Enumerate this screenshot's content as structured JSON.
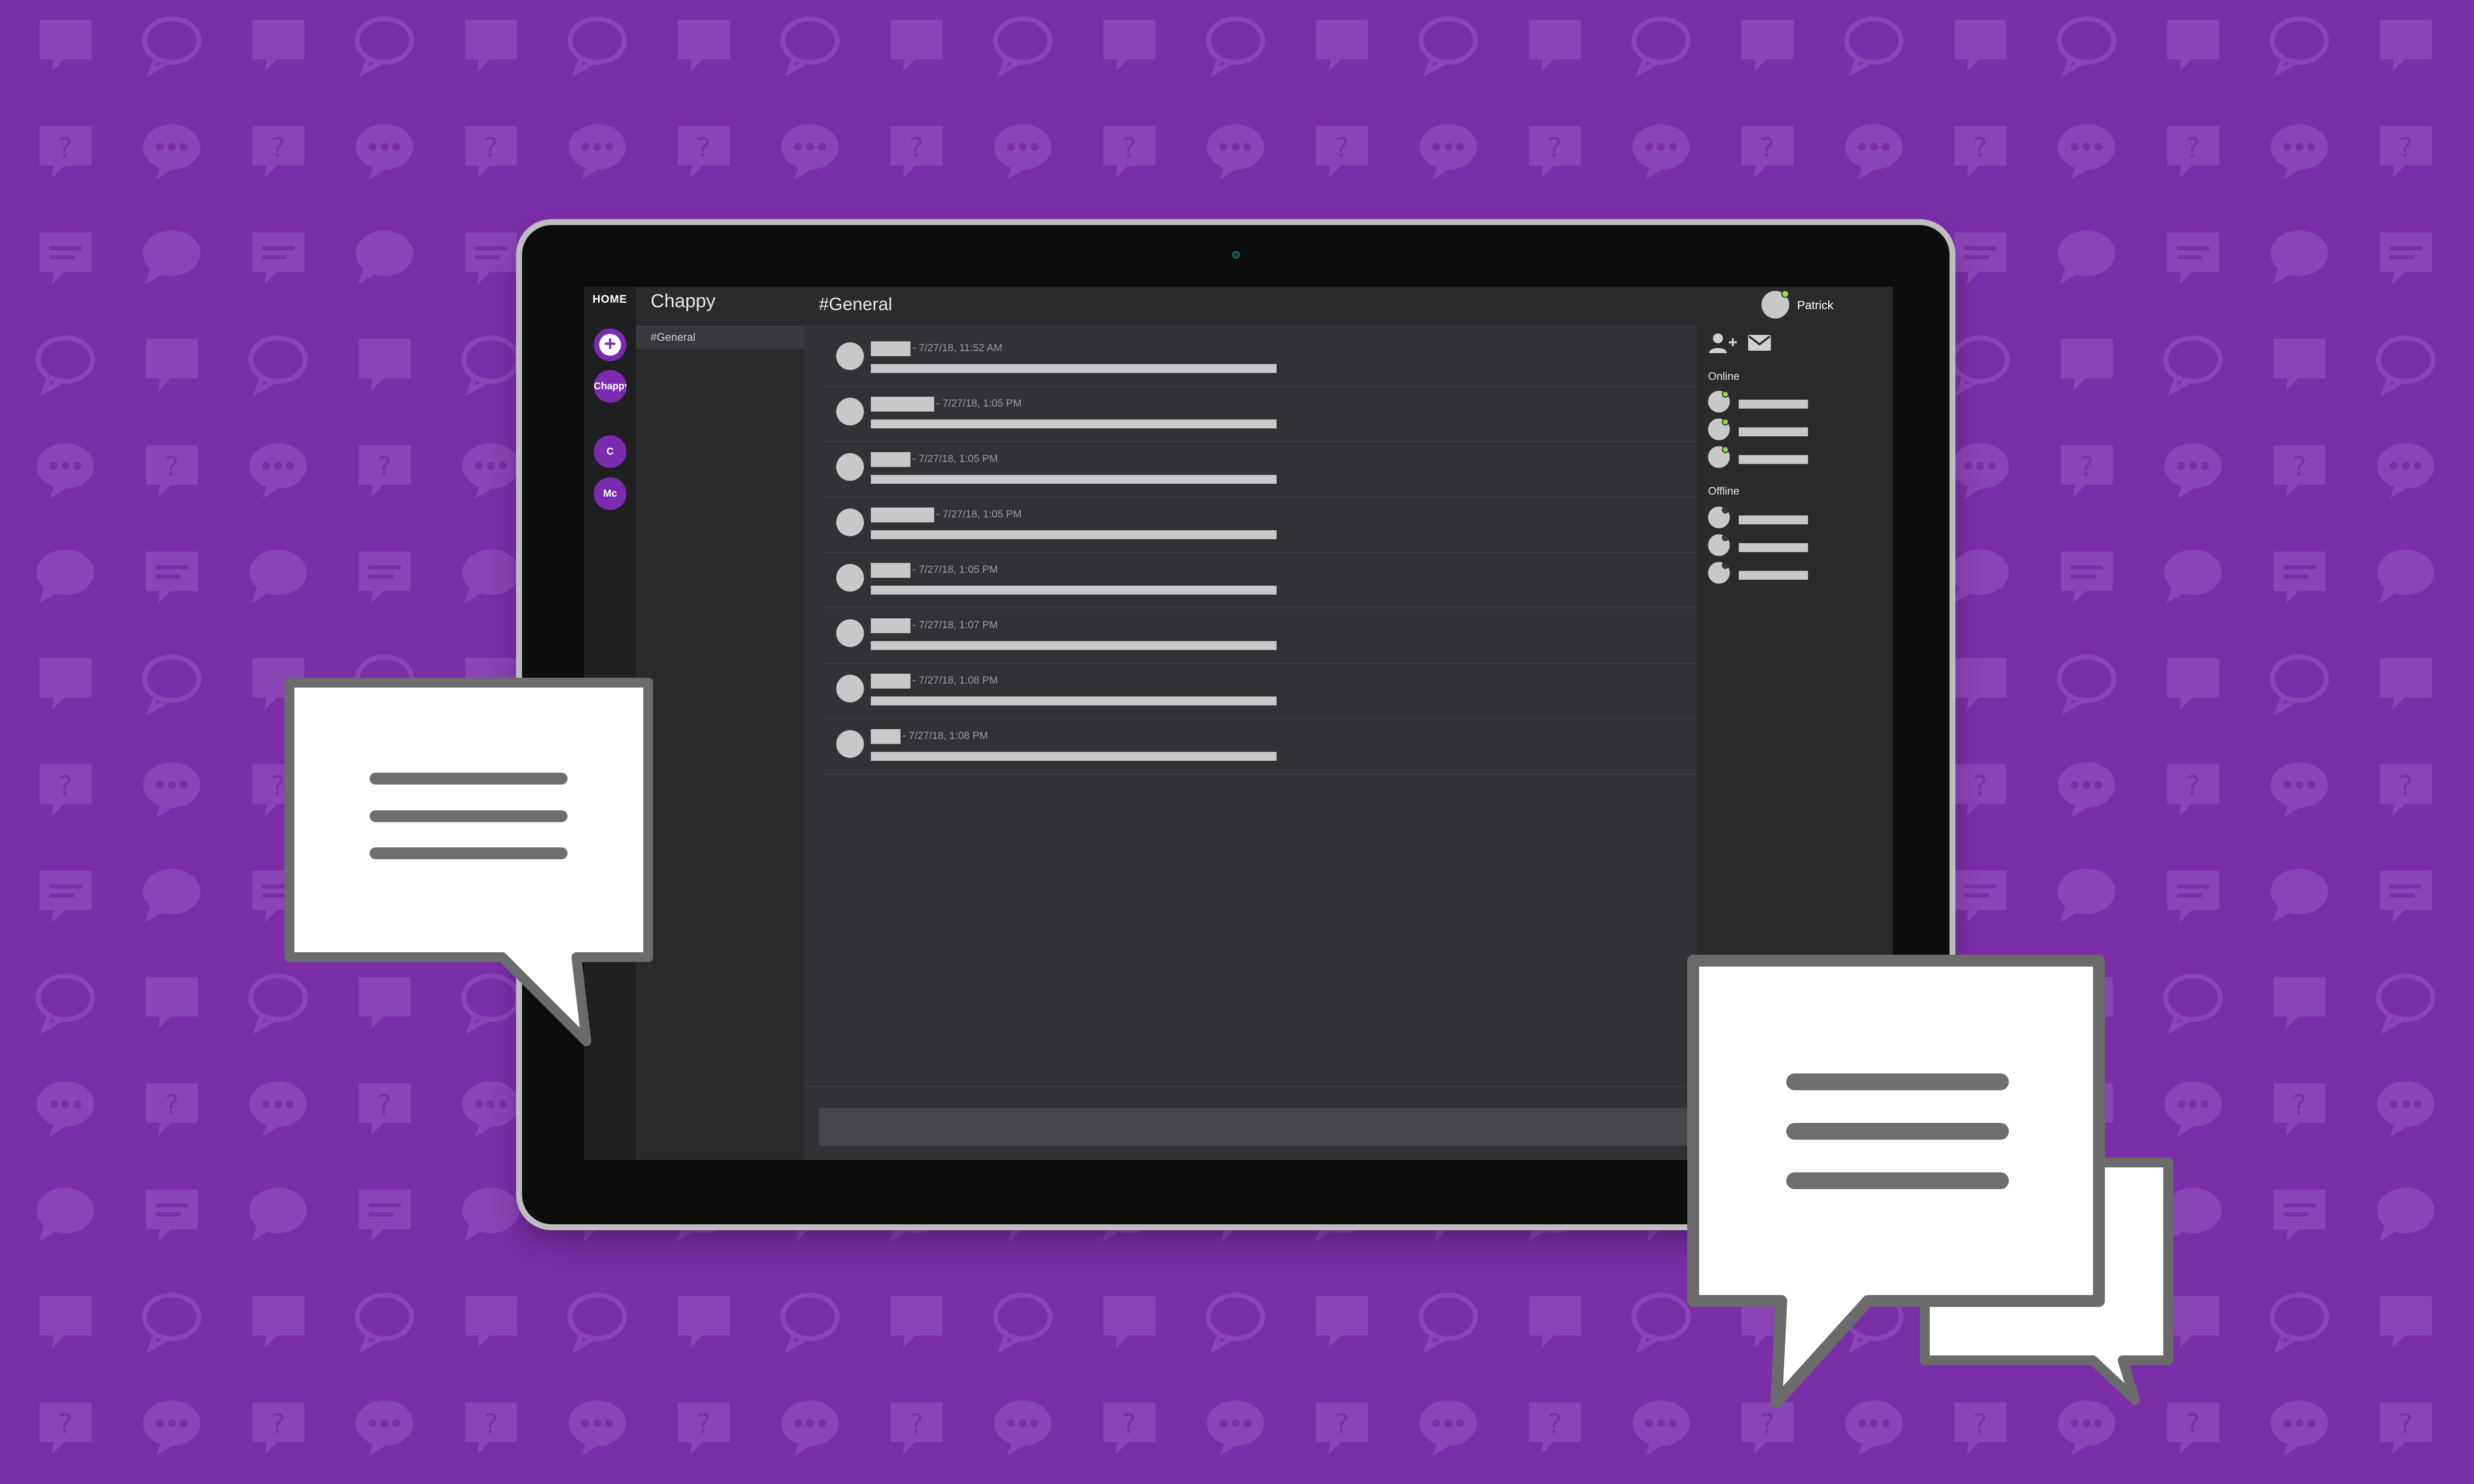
{
  "colors": {
    "background": "#7a2ea8",
    "pattern": "#8f4cba",
    "accent": "#7b2bb0",
    "online": "#8ee33a"
  },
  "rail": {
    "home_label": "HOME",
    "add_icon": "plus-icon",
    "servers": [
      {
        "label": "Chappy",
        "active": true
      },
      {
        "label": "C",
        "active": false
      },
      {
        "label": "Mc",
        "active": false
      }
    ]
  },
  "server": {
    "title": "Chappy",
    "channels": [
      {
        "label": "#General",
        "selected": true
      }
    ]
  },
  "header": {
    "channel_title": "#General",
    "user": {
      "name": "Patrick",
      "status": "online"
    }
  },
  "messages": [
    {
      "timestamp": "- 7/27/18, 11:52 AM"
    },
    {
      "timestamp": "- 7/27/18, 1:05 PM"
    },
    {
      "timestamp": "- 7/27/18, 1:05 PM"
    },
    {
      "timestamp": "- 7/27/18, 1:05 PM"
    },
    {
      "timestamp": "- 7/27/18, 1:05 PM"
    },
    {
      "timestamp": "- 7/27/18, 1:07 PM"
    },
    {
      "timestamp": "- 7/27/18, 1:08 PM"
    },
    {
      "timestamp": "- 7/27/18, 1:08 PM"
    }
  ],
  "members_panel": {
    "icons": [
      "add-user-icon",
      "mail-icon"
    ],
    "online_label": "Online",
    "offline_label": "Offline",
    "online_members": [
      {},
      {},
      {}
    ],
    "offline_members": [
      {},
      {},
      {}
    ]
  }
}
